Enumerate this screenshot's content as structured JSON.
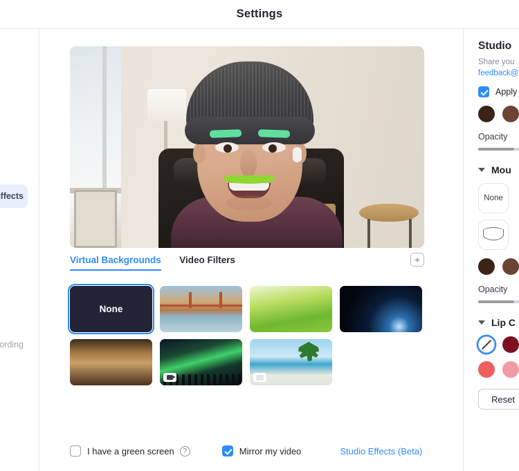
{
  "window": {
    "title": "Settings"
  },
  "sidebar": {
    "items": [
      {
        "label": "Backgrounds & Effects",
        "selected": true
      },
      {
        "label": "Recording",
        "selected": false
      }
    ]
  },
  "preview": {
    "alt": "video-self-preview",
    "effects_applied": [
      "green-eyebrows",
      "green-mustache"
    ]
  },
  "tabs": [
    {
      "label": "Virtual Backgrounds",
      "active": true
    },
    {
      "label": "Video Filters",
      "active": false
    }
  ],
  "add_button": {
    "glyph": "+",
    "name": "add-background-button"
  },
  "backgrounds": [
    {
      "label": "None",
      "kind": "none",
      "selected": true,
      "video": false
    },
    {
      "label": "",
      "kind": "bridge",
      "selected": false,
      "video": false
    },
    {
      "label": "",
      "kind": "grass",
      "selected": false,
      "video": false
    },
    {
      "label": "",
      "kind": "earth",
      "selected": false,
      "video": false
    },
    {
      "label": "",
      "kind": "lobby",
      "selected": false,
      "video": false
    },
    {
      "label": "",
      "kind": "aurora",
      "selected": false,
      "video": true
    },
    {
      "label": "",
      "kind": "beach",
      "selected": false,
      "video": true
    }
  ],
  "bottom": {
    "green_screen_label": "I have a green screen",
    "green_screen_checked": false,
    "help_glyph": "?",
    "mirror_label": "Mirror my video",
    "mirror_checked": true,
    "studio_effects_link": "Studio Effects (Beta)"
  },
  "studio": {
    "title": "Studio",
    "subtitle_line1": "Share you",
    "subtitle_line2": "feedback@",
    "apply_label": "Apply",
    "apply_checked": true,
    "eyebrow_swatches": [
      "#3b2318",
      "#6b4433"
    ],
    "opacity_label": "Opacity",
    "opacity_percent": 43,
    "mustache": {
      "section_label": "Mou",
      "expanded": true,
      "none_tile_label": "None",
      "swatches": [
        "#3b2318",
        "#6b4433"
      ],
      "opacity_label": "Opacity",
      "opacity_percent": 43
    },
    "lip_color": {
      "section_label": "Lip C",
      "expanded": true,
      "swatches": [
        {
          "color": "#ffffff",
          "none": true,
          "selected": true
        },
        {
          "color": "#7d1122",
          "none": false,
          "selected": false
        },
        {
          "color": "#ef5f5f",
          "none": false,
          "selected": false
        },
        {
          "color": "#f29aa3",
          "none": false,
          "selected": false
        }
      ]
    },
    "reset_label": "Reset",
    "accent_color": "#2d8cff"
  }
}
